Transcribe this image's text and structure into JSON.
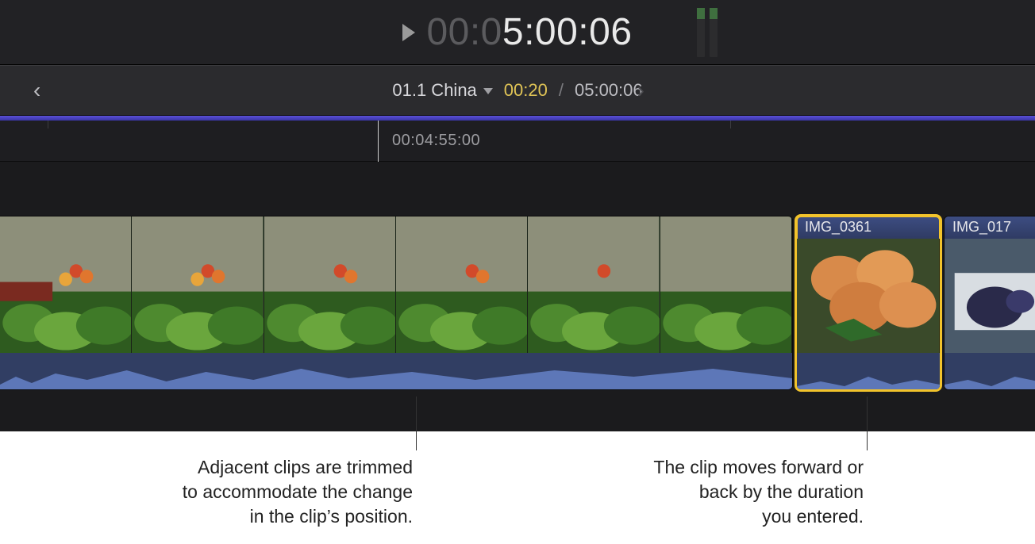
{
  "topbar": {
    "timecode_dim": "00:0",
    "timecode_bright": "5:00:06"
  },
  "projectbar": {
    "name": "01.1 China",
    "elapsed": "00:20",
    "divider": "/",
    "total": "05:00:06"
  },
  "ruler": {
    "label": "00:04:55:00"
  },
  "clips": {
    "clip2_name": "IMG_0361",
    "clip3_name": "IMG_017"
  },
  "annotations": {
    "left_line1": "Adjacent clips are trimmed",
    "left_line2": "to accommodate the change",
    "left_line3": "in the clip’s position.",
    "right_line1": "The clip moves forward or",
    "right_line2": "back by the duration",
    "right_line3": "you entered."
  }
}
